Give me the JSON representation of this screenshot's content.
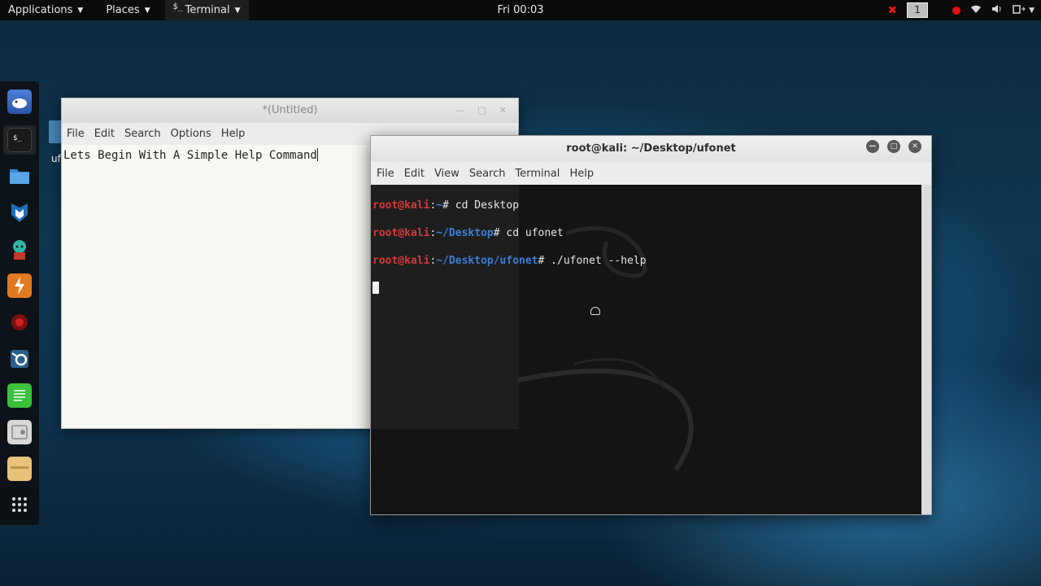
{
  "top_panel": {
    "applications_label": "Applications",
    "places_label": "Places",
    "terminal_label": "Terminal",
    "terminal_glyph": "$_",
    "clock": "Fri 00:03",
    "workspace": "1"
  },
  "dock": {
    "items": [
      "beef-icon",
      "terminal-icon",
      "files-icon",
      "metasploit-icon",
      "armitage-icon",
      "burpsuite-icon",
      "faraday-icon",
      "maltego-icon",
      "text-editor-icon",
      "cherrytree-icon",
      "leafpad-icon",
      "show-apps-icon"
    ]
  },
  "desktop": {
    "icon_label": "uf"
  },
  "gedit": {
    "title": "*(Untitled)",
    "menu": [
      "File",
      "Edit",
      "Search",
      "Options",
      "Help"
    ],
    "text": "Lets Begin With A Simple Help Command"
  },
  "terminal": {
    "title": "root@kali: ~/Desktop/ufonet",
    "menu": [
      "File",
      "Edit",
      "View",
      "Search",
      "Terminal",
      "Help"
    ],
    "lines": [
      {
        "user": "root@kali",
        "sep": ":",
        "path": "~",
        "cmd": "# cd Desktop"
      },
      {
        "user": "root@kali",
        "sep": ":",
        "path": "~/Desktop",
        "cmd": "# cd ufonet"
      },
      {
        "user": "root@kali",
        "sep": ":",
        "path": "~/Desktop/ufonet",
        "cmd": "# ./ufonet --help"
      }
    ]
  },
  "colors": {
    "prompt_user": "#d33a3a",
    "prompt_path": "#3b7fd9",
    "panel_bg": "#0b0b0b",
    "terminal_bg": "#141414"
  }
}
